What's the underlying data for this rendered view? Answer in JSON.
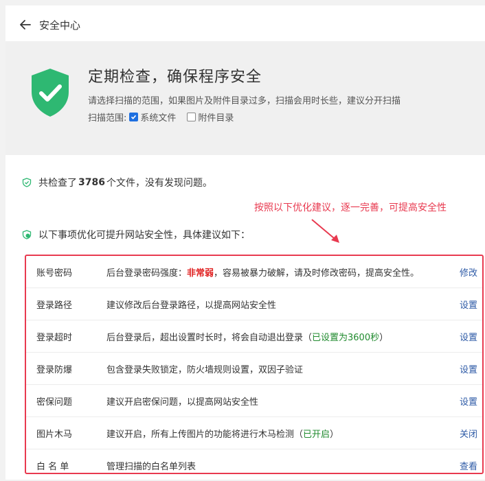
{
  "header": {
    "title": "安全中心"
  },
  "hero": {
    "title": "定期检查，确保程序安全",
    "desc": "请选择扫描的范围，如果图片及附件目录过多，扫描会用时长些，建议分开扫描",
    "scope_label": "扫描范围:",
    "options": [
      {
        "label": "系统文件",
        "checked": true
      },
      {
        "label": "附件目录",
        "checked": false
      }
    ]
  },
  "summary": {
    "prefix": "共检查了",
    "count": "3786",
    "suffix": "个文件，没有发现问题。"
  },
  "annotation": "按照以下优化建议，逐一完善，可提高安全性",
  "advice_title": "以下事项优化可提升网站安全性，具体建议如下：",
  "rows": [
    {
      "name": "账号密码",
      "desc_pre": "后台登录密码强度：",
      "desc_hl": "非常弱",
      "desc_post": "，容易被暴力破解，请及时修改密码，提高安全性。",
      "action": "修改"
    },
    {
      "name": "登录路径",
      "desc_pre": "建议修改后台登录路径，以提高网站安全性",
      "desc_hl": "",
      "desc_post": "",
      "action": "设置"
    },
    {
      "name": "登录超时",
      "desc_pre": "后台登录后，超出设置时长时，将会自动退出登录（",
      "desc_hl": "已设置为3600秒",
      "desc_post": "）",
      "action": "设置"
    },
    {
      "name": "登录防爆",
      "desc_pre": "包含登录失败锁定，防火墙规则设置，双因子验证",
      "desc_hl": "",
      "desc_post": "",
      "action": "设置"
    },
    {
      "name": "密保问题",
      "desc_pre": "建议开启密保问题，以提高网站安全性",
      "desc_hl": "",
      "desc_post": "",
      "action": "设置"
    },
    {
      "name": "图片木马",
      "desc_pre": "建议开启，所有上传图片的功能将进行木马检测（",
      "desc_hl": "已开启",
      "desc_post": "）",
      "action": "关闭"
    },
    {
      "name": "白 名 单",
      "desc_pre": "管理扫描的白名单列表",
      "desc_hl": "",
      "desc_post": "",
      "action": "查看"
    }
  ],
  "colors": {
    "accent_red": "#e8394f",
    "shield_green": "#2eb872",
    "link_blue": "#2d5aa6",
    "ok_green": "#1f8a2d"
  }
}
